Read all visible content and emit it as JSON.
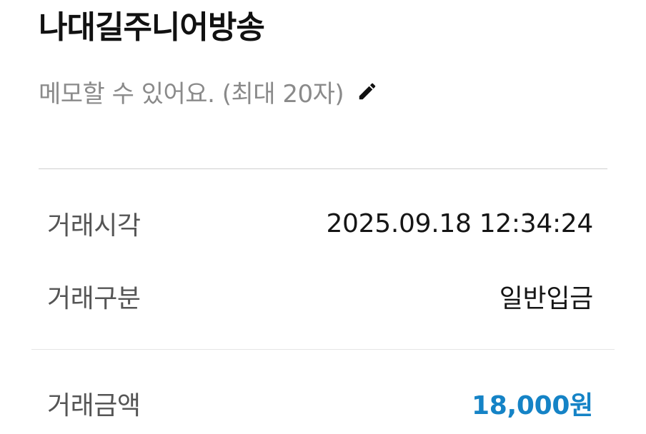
{
  "header": {
    "title": "나대길주니어방송"
  },
  "memo": {
    "placeholder": "메모할 수 있어요. (최대 20자)",
    "edit_icon": "pencil-icon"
  },
  "details": {
    "time_label": "거래시각",
    "time_value": "2025.09.18 12:34:24",
    "type_label": "거래구분",
    "type_value": "일반입금",
    "amount_label": "거래금액",
    "amount_value": "18,000원"
  },
  "colors": {
    "amount": "#1583c6",
    "memo_text": "#8a8a8a",
    "label_text": "#555555"
  }
}
